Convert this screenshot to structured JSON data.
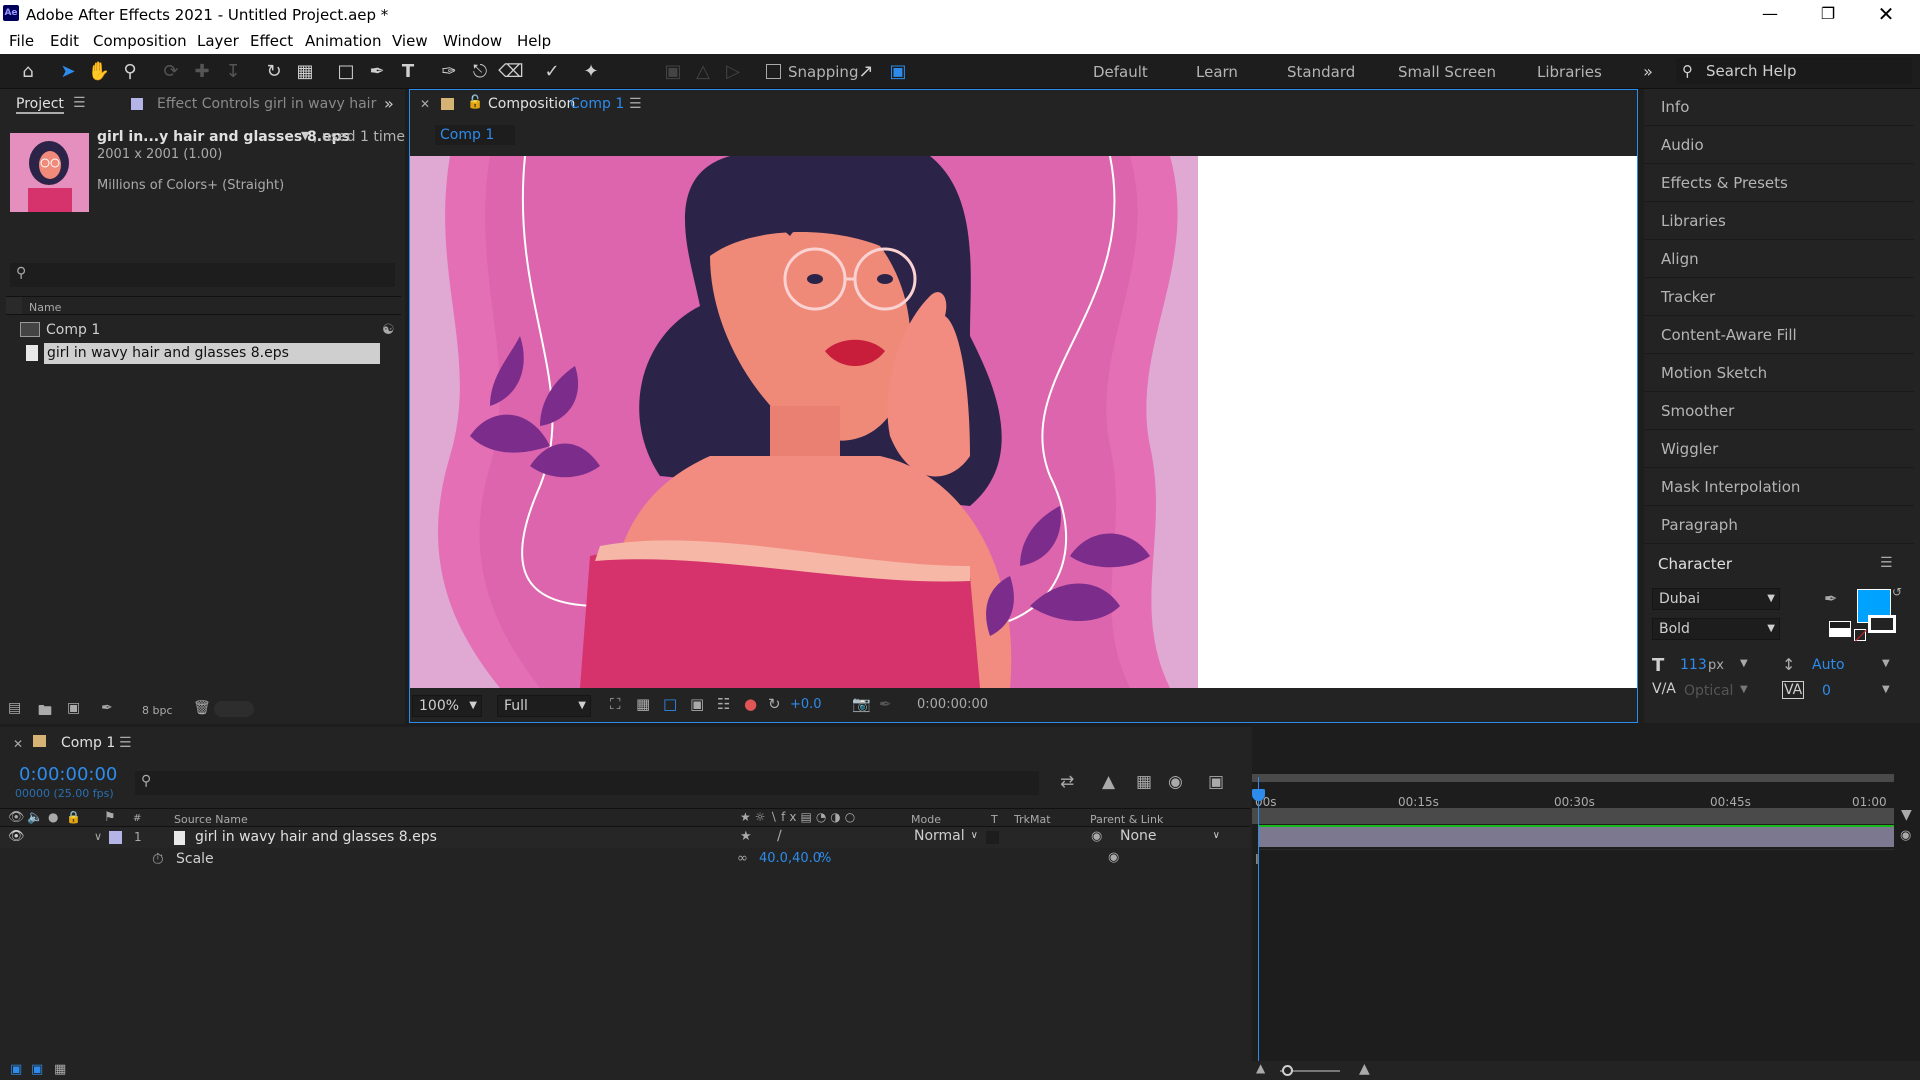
{
  "window": {
    "title": "Adobe After Effects 2021 - Untitled Project.aep *",
    "logo_text": "Ae"
  },
  "menu": [
    "File",
    "Edit",
    "Composition",
    "Layer",
    "Effect",
    "Animation",
    "View",
    "Window",
    "Help"
  ],
  "toolbar": {
    "snapping_label": "Snapping",
    "workspaces": [
      "Default",
      "Learn",
      "Standard",
      "Small Screen",
      "Libraries"
    ],
    "search_placeholder": "Search Help"
  },
  "project_panel": {
    "tab_project": "Project",
    "tab_effect_controls": "Effect Controls girl in wavy hair",
    "selected_name": "girl in...y hair and glasses 8.eps",
    "used_text": ", used 1 time",
    "dimensions": "2001 x 2001 (1.00)",
    "colors": "Millions of Colors+ (Straight)",
    "column_name": "Name",
    "items": [
      {
        "name": "Comp 1",
        "type": "comp"
      },
      {
        "name": "girl in wavy hair and glasses 8.eps",
        "type": "file",
        "selected": true
      }
    ],
    "bpc": "8 bpc"
  },
  "comp_panel": {
    "tab_label_prefix": "Composition",
    "tab_comp_name": "Comp 1",
    "breadcrumb": "Comp 1",
    "zoom": "100%",
    "resolution": "Full",
    "exposure": "+0.0",
    "timecode": "0:00:00:00"
  },
  "right_panel": {
    "items": [
      "Info",
      "Audio",
      "Effects & Presets",
      "Libraries",
      "Align",
      "Tracker",
      "Content-Aware Fill",
      "Motion Sketch",
      "Smoother",
      "Wiggler",
      "Mask Interpolation",
      "Paragraph"
    ],
    "character": {
      "title": "Character",
      "font": "Dubai",
      "style": "Bold",
      "size": "113",
      "size_unit": "px",
      "leading": "Auto",
      "kerning": "Optical",
      "tracking": "0",
      "fill_color": "#00a2ff",
      "stroke_color": "#ffffff"
    }
  },
  "timeline": {
    "tab": "Comp 1",
    "current_time": "0:00:00:00",
    "fps": "00000 (25.00 fps)",
    "columns": {
      "source_name": "Source Name",
      "mode": "Mode",
      "t": "T",
      "trkmat": "TrkMat",
      "parent_link": "Parent & Link",
      "num": "#"
    },
    "layers": [
      {
        "num": "1",
        "name": "girl in wavy hair and glasses 8.eps",
        "mode": "Normal",
        "parent": "None"
      }
    ],
    "property": {
      "name": "Scale",
      "value": "40.0,40.0",
      "unit": "%"
    },
    "ruler": [
      "00s",
      "00:15s",
      "00:30s",
      "00:45s",
      "01:00"
    ],
    "label_color": "#b4b4e6"
  }
}
